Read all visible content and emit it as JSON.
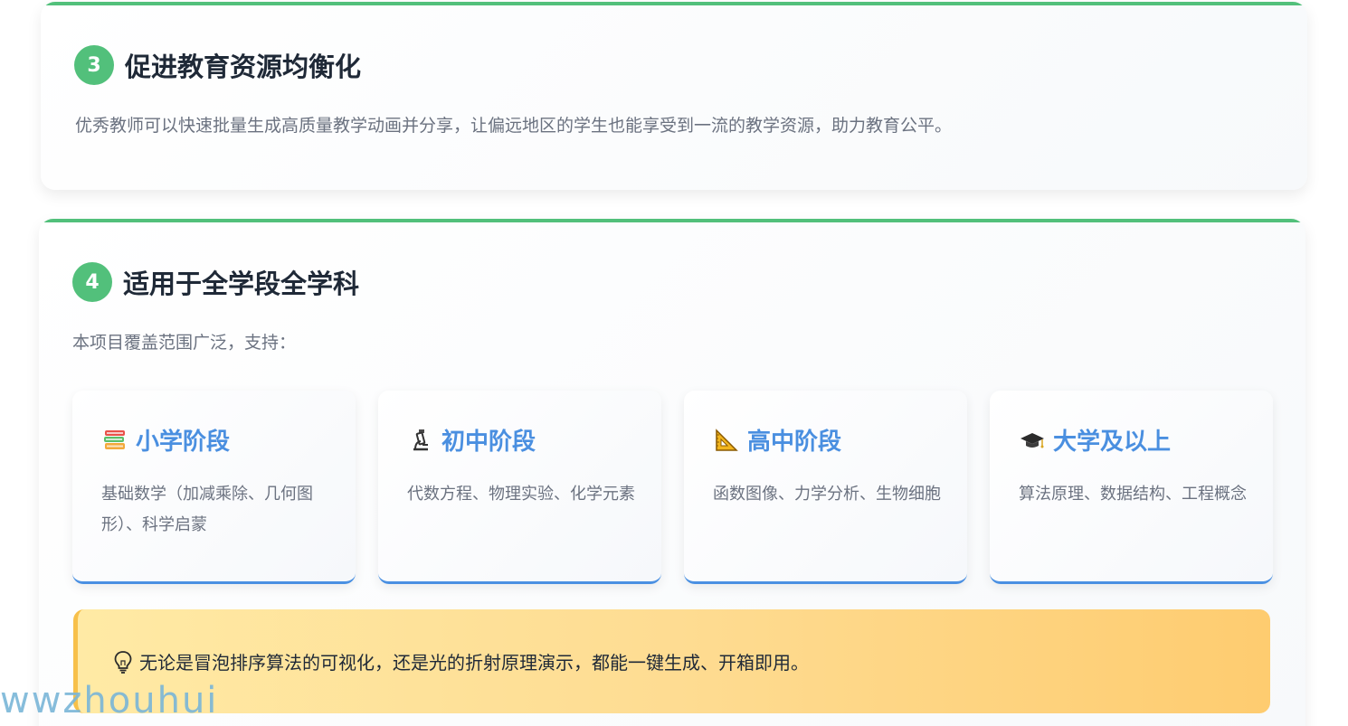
{
  "section3": {
    "number": "3",
    "title": "促进教育资源均衡化",
    "description": "优秀教师可以快速批量生成高质量教学动画并分享，让偏远地区的学生也能享受到一流的教学资源，助力教育公平。"
  },
  "section4": {
    "number": "4",
    "title": "适用于全学段全学科",
    "intro": "本项目覆盖范围广泛，支持：",
    "stages": [
      {
        "icon": "books-icon",
        "label": "小学阶段",
        "description": "基础数学（加减乘除、几何图形）、科学启蒙"
      },
      {
        "icon": "microscope-icon",
        "label": "初中阶段",
        "description": "代数方程、物理实验、化学元素"
      },
      {
        "icon": "triangle-ruler-icon",
        "label": "高中阶段",
        "description": "函数图像、力学分析、生物细胞"
      },
      {
        "icon": "graduation-cap-icon",
        "label": "大学及以上",
        "description": "算法原理、数据结构、工程概念"
      }
    ],
    "tip": {
      "icon": "lightbulb-icon",
      "text": "无论是冒泡排序算法的可视化，还是光的折射原理演示，都能一键生成、开箱即用。"
    }
  },
  "watermark": "wwzhouhui",
  "colors": {
    "accent_green": "#52c07b",
    "accent_blue": "#4a8fe0",
    "tip_gradient_start": "#ffeaa5",
    "tip_gradient_end": "#fecc70"
  }
}
